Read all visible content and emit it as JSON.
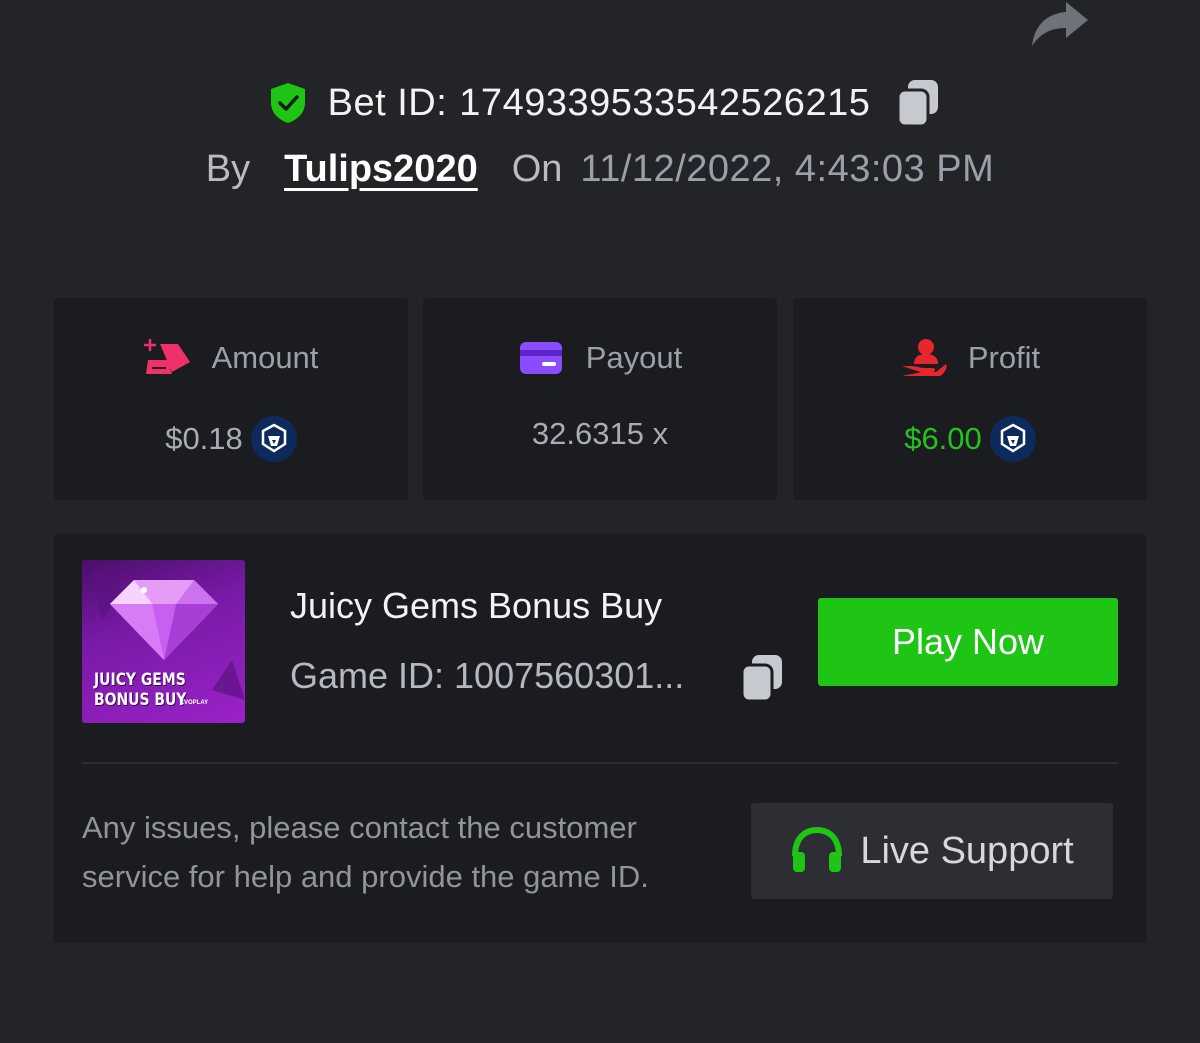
{
  "header": {
    "bet_id_label": "Bet ID:",
    "bet_id": "1749339533542526215",
    "by_label": "By",
    "username": "Tulips2020",
    "on_label": "On",
    "datetime": "11/12/2022, 4:43:03 PM"
  },
  "stats": {
    "amount": {
      "label": "Amount",
      "value": "$0.18",
      "icon": "money-pile-icon",
      "icon_color": "#f0306a"
    },
    "payout": {
      "label": "Payout",
      "value": "32.6315 x",
      "icon": "card-icon",
      "icon_color": "#8b4bff"
    },
    "profit": {
      "label": "Profit",
      "value": "$6.00",
      "icon": "hand-user-icon",
      "icon_color": "#e8262e",
      "value_color": "#24c21e"
    }
  },
  "game": {
    "thumb_text_line1": "JUICY GEMS",
    "thumb_text_line2": "BONUS BUY",
    "thumb_brand": "EVOPLAY",
    "title": "Juicy Gems Bonus Buy",
    "game_id_text": "Game ID: 1007560301...",
    "play_label": "Play Now"
  },
  "support": {
    "message": "Any issues, please contact the customer service for help and provide the game ID.",
    "button_label": "Live Support"
  },
  "colors": {
    "background": "#232428",
    "card": "#1b1c20",
    "accent_green": "#1ec515",
    "verified_green": "#1ec515"
  }
}
